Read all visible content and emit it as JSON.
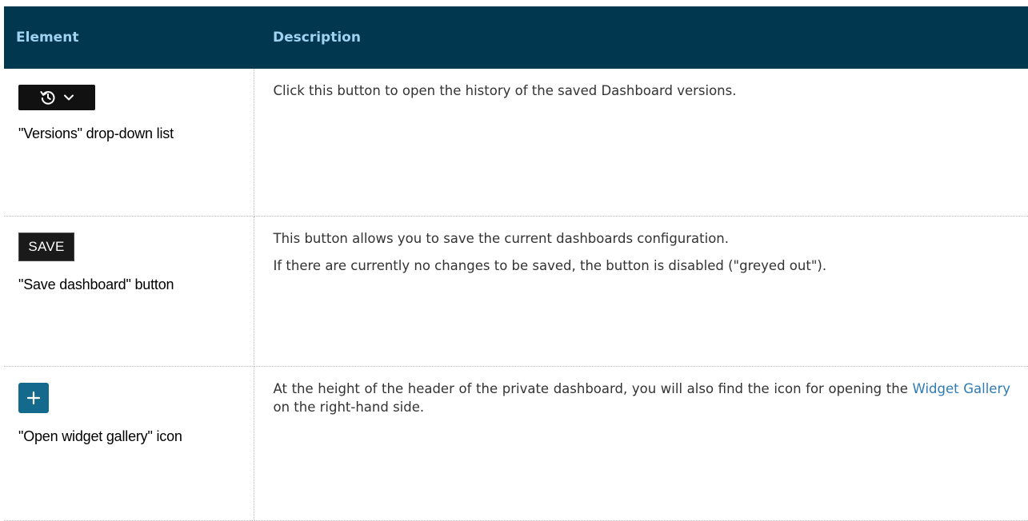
{
  "table": {
    "headers": {
      "element": "Element",
      "description": "Description"
    },
    "rows": [
      {
        "icon": "history-icon",
        "save_label": "",
        "element_label": "\"Versions\" drop-down list",
        "description": [
          "Click this button to open the history of the saved Dashboard versions."
        ]
      },
      {
        "icon": "save-button",
        "save_label": "SAVE",
        "element_label": "\"Save dashboard\" button",
        "description": [
          "This button allows you to save the current dashboards configuration.",
          "If there are currently no changes to be saved, the button is disabled (\"greyed out\")."
        ]
      },
      {
        "icon": "plus-icon",
        "save_label": "",
        "element_label": "\"Open widget gallery\" icon",
        "description_parts": {
          "before": "At the height of the header of the private dashboard, you will also find the icon for opening the ",
          "link": "Widget Gallery",
          "after": " on the right-hand side."
        }
      }
    ]
  },
  "colors": {
    "header_bg": "#01374f",
    "header_text": "#9fd3f0",
    "link": "#2e7bb5",
    "plus_bg": "#136a8c"
  }
}
